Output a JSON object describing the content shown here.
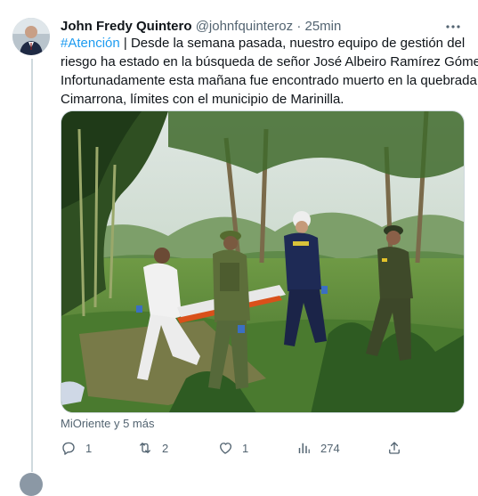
{
  "tweet": {
    "author_name": "John Fredy Quintero",
    "handle": "@johnfquinteroz",
    "separator": "·",
    "time": "25min",
    "hashtag": "#Atención",
    "text_line1_rest": " | Desde la semana pasada, nuestro equipo de gestión del",
    "text_line2": "riesgo ha estado en la búsqueda de señor José Albeiro Ramírez Gómez.",
    "text_line3": "Infortunadamente esta mañana fue encontrado muerto en la quebrada La",
    "text_line4": "Cimarrona, límites con el municipio de Marinilla.",
    "tagged": "MiOriente y 5 más"
  },
  "actions": {
    "reply_count": "1",
    "retweet_count": "2",
    "like_count": "1",
    "views_count": "274"
  },
  "icons": {
    "more": "more-horizontal-icon",
    "reply": "reply-icon",
    "retweet": "retweet-icon",
    "like": "heart-icon",
    "views": "views-chart-icon",
    "share": "share-icon"
  },
  "colors": {
    "hashtag": "#1d9bf0",
    "secondary_text": "#536471",
    "primary_text": "#0f1419"
  }
}
